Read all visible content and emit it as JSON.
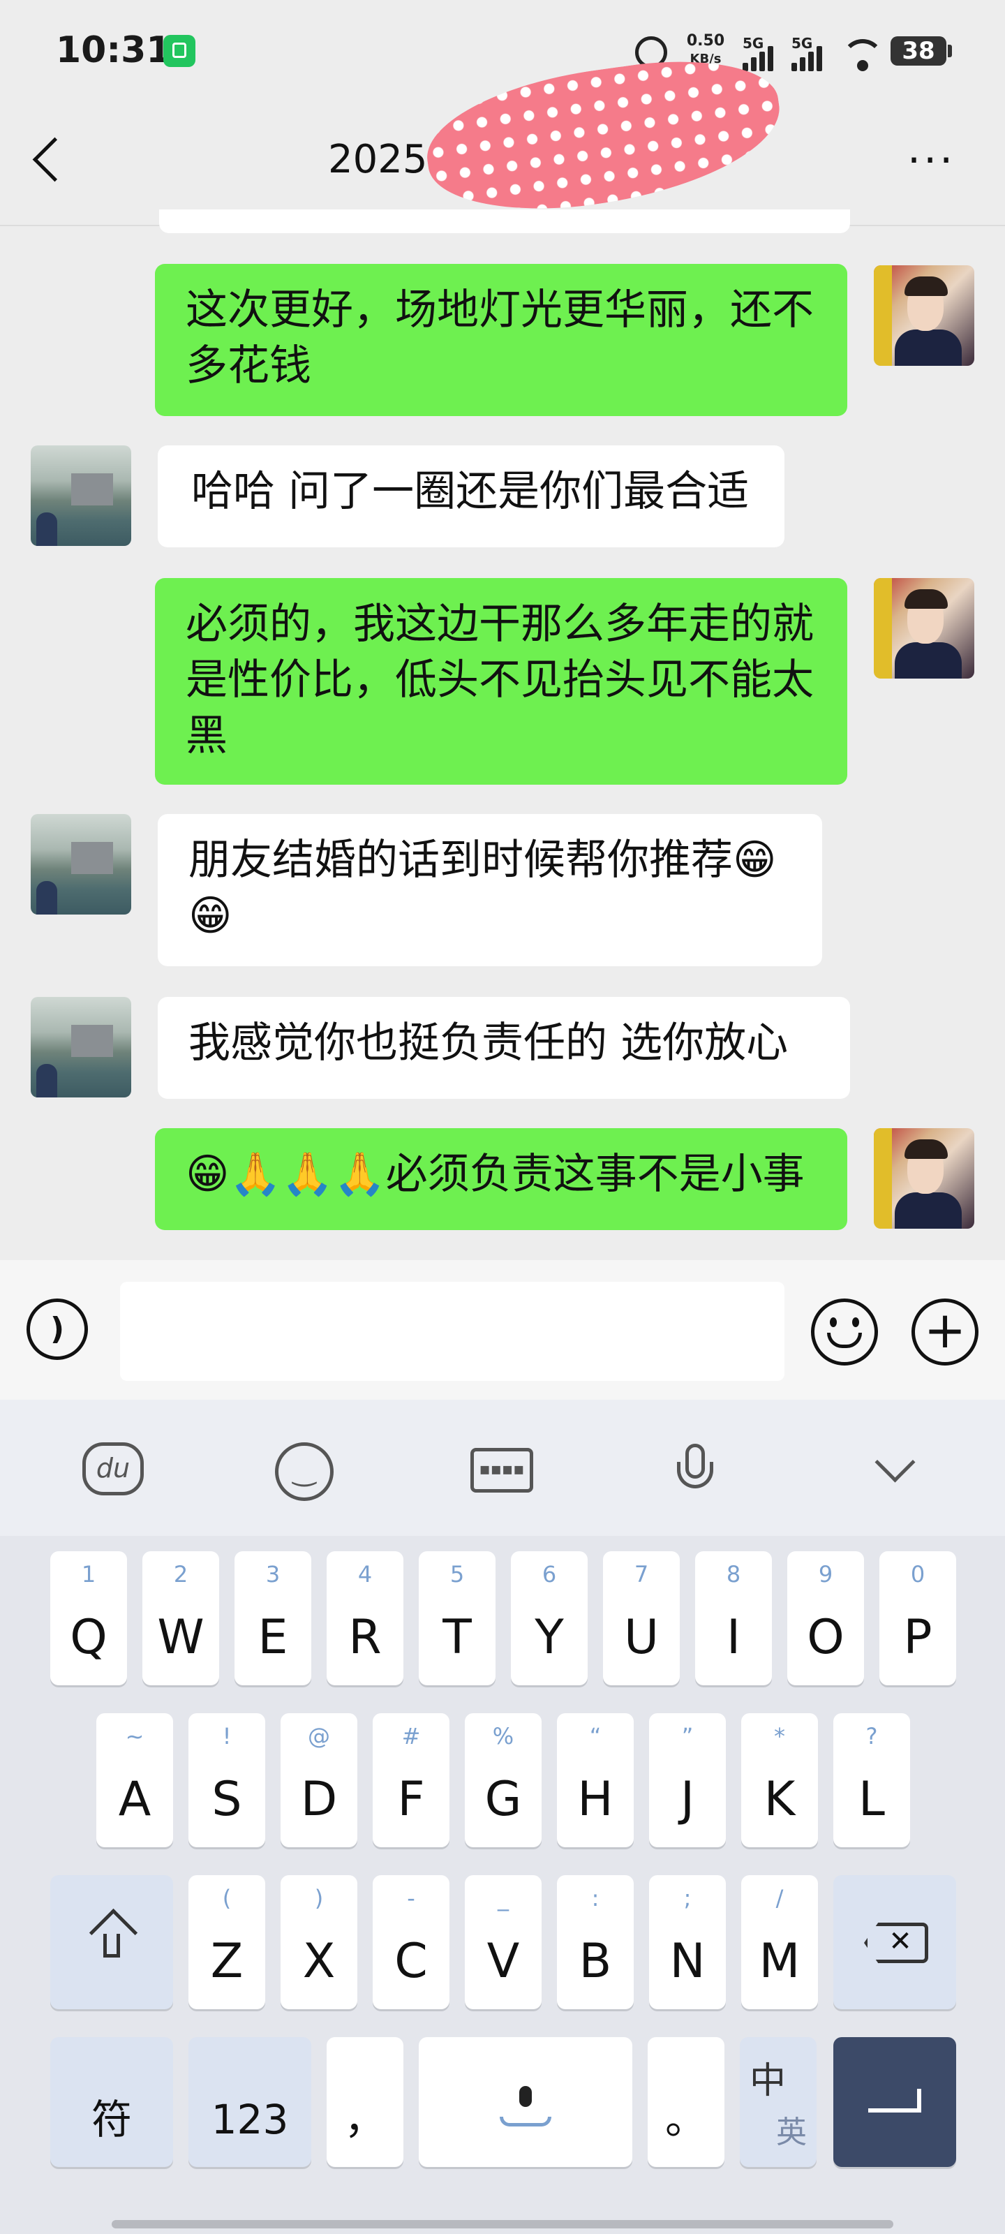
{
  "status_bar": {
    "time": "10:31",
    "speed_value": "0.50",
    "speed_unit": "KB/s",
    "network1": "5G",
    "network2": "5G",
    "battery": "38"
  },
  "header": {
    "title": "2025",
    "back_icon": "chevron-left-icon",
    "more_icon": "more-dots-icon"
  },
  "messages": [
    {
      "sender": "me",
      "text": "这次更好，场地灯光更华丽，还不多花钱"
    },
    {
      "sender": "other",
      "text": "哈哈 问了一圈还是你们最合适"
    },
    {
      "sender": "me",
      "text": "必须的，我这边干那么多年走的就是性价比，低头不见抬头见不能太黑"
    },
    {
      "sender": "other",
      "text": "朋友结婚的话到时候帮你推荐😁😁"
    },
    {
      "sender": "other",
      "text": "我感觉你也挺负责任的 选你放心"
    },
    {
      "sender": "me",
      "text": "😁🙏🙏🙏必须负责这事不是小事"
    }
  ],
  "input_bar": {
    "voice_icon": "voice-icon",
    "emoji_icon": "emoji-icon",
    "plus_icon": "plus-icon",
    "value": ""
  },
  "keyboard_toolbar": [
    "du-logo-icon",
    "smiley-icon",
    "keyboard-icon",
    "microphone-icon",
    "chevron-down-icon"
  ],
  "keyboard": {
    "row1": [
      {
        "main": "Q",
        "hint": "1"
      },
      {
        "main": "W",
        "hint": "2"
      },
      {
        "main": "E",
        "hint": "3"
      },
      {
        "main": "R",
        "hint": "4"
      },
      {
        "main": "T",
        "hint": "5"
      },
      {
        "main": "Y",
        "hint": "6"
      },
      {
        "main": "U",
        "hint": "7"
      },
      {
        "main": "I",
        "hint": "8"
      },
      {
        "main": "O",
        "hint": "9"
      },
      {
        "main": "P",
        "hint": "0"
      }
    ],
    "row2": [
      {
        "main": "A",
        "hint": "~"
      },
      {
        "main": "S",
        "hint": "!"
      },
      {
        "main": "D",
        "hint": "@"
      },
      {
        "main": "F",
        "hint": "#"
      },
      {
        "main": "G",
        "hint": "%"
      },
      {
        "main": "H",
        "hint": "“"
      },
      {
        "main": "J",
        "hint": "”"
      },
      {
        "main": "K",
        "hint": "*"
      },
      {
        "main": "L",
        "hint": "?"
      }
    ],
    "row3": [
      {
        "main": "Z",
        "hint": "("
      },
      {
        "main": "X",
        "hint": ")"
      },
      {
        "main": "C",
        "hint": "-"
      },
      {
        "main": "V",
        "hint": "_"
      },
      {
        "main": "B",
        "hint": ":"
      },
      {
        "main": "N",
        "hint": ";"
      },
      {
        "main": "M",
        "hint": "/"
      }
    ],
    "symbols_key": "符",
    "numbers_key": "123",
    "comma_key": "，",
    "period_key": "。",
    "lang_key_top": "中",
    "lang_key_bottom": "英",
    "shift_icon": "shift-icon",
    "backspace_icon": "backspace-icon",
    "space_icon": "space-mic-icon",
    "enter_icon": "enter-icon"
  },
  "colors": {
    "my_bubble": "#6ef050",
    "their_bubble": "#ffffff",
    "background": "#ededed"
  }
}
